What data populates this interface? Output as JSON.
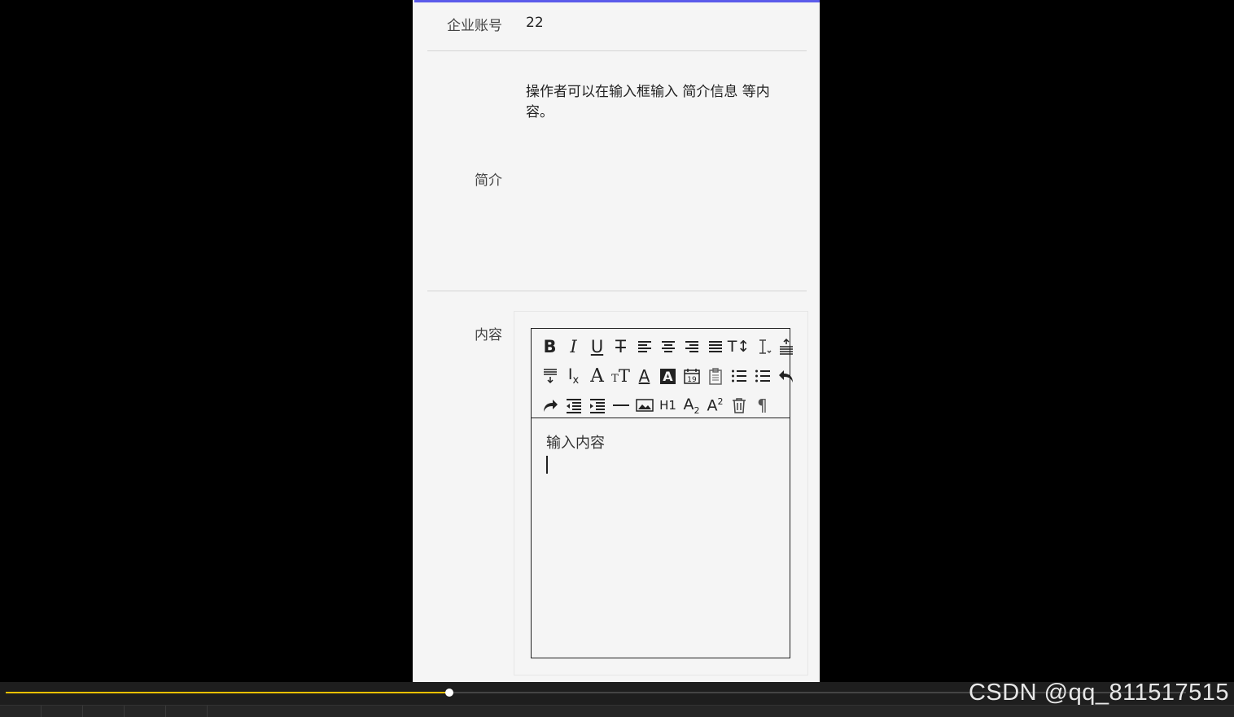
{
  "form": {
    "account_label": "企业账号",
    "account_value": "22",
    "intro_text": "操作者可以在输入框输入   简介信息    等内容。",
    "intro_label": "简介",
    "content_label": "内容"
  },
  "editor": {
    "toolbar_rows": [
      [
        "bold-icon",
        "italic-icon",
        "underline-icon",
        "strikethrough-icon",
        "align-left-icon",
        "align-center-icon",
        "align-right-icon",
        "align-justify-icon",
        "text-size-icon",
        "line-height-icon",
        "paragraph-spacing-top-icon"
      ],
      [
        "paragraph-spacing-bottom-icon",
        "clear-format-icon",
        "font-family-icon",
        "font-size-icon",
        "font-color-icon",
        "background-color-icon",
        "date-icon",
        "clipboard-icon",
        "ordered-list-icon",
        "unordered-list-icon",
        "undo-icon"
      ],
      [
        "redo-icon",
        "outdent-icon",
        "indent-icon",
        "horizontal-rule-icon",
        "image-icon",
        "heading-icon",
        "subscript-icon",
        "superscript-icon",
        "delete-icon",
        "paragraph-mark-icon"
      ]
    ],
    "content_text": "输入内容"
  },
  "player": {
    "progress_fraction": 0.376
  },
  "watermark": "CSDN @qq_811517515"
}
